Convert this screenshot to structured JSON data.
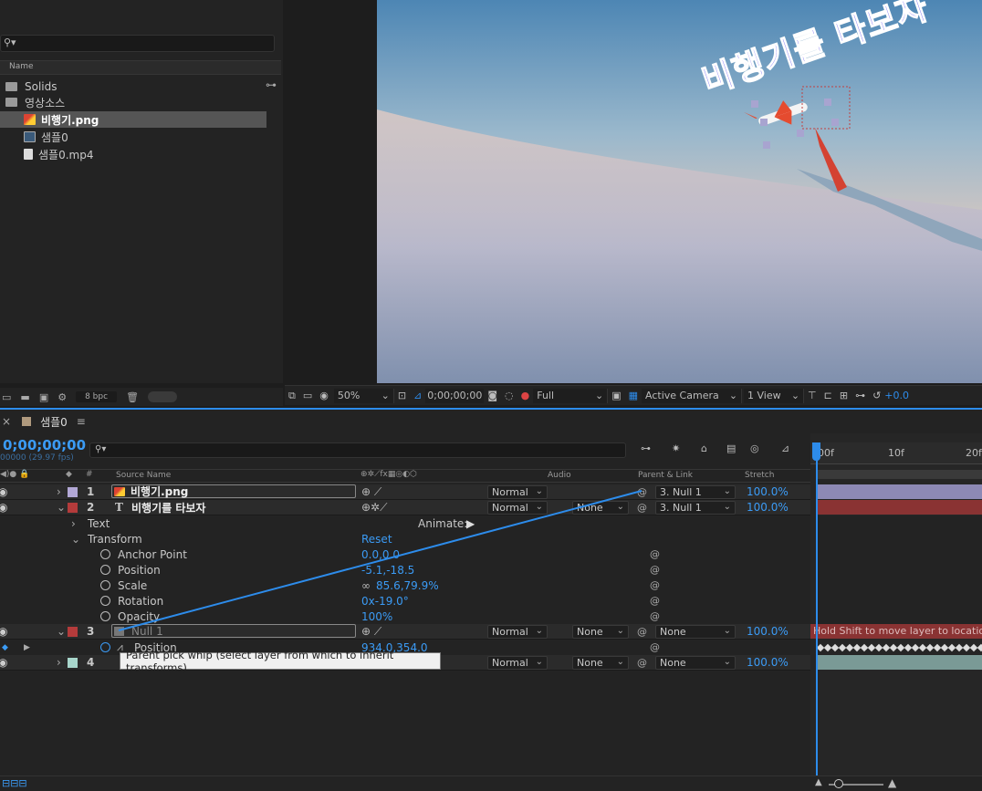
{
  "project": {
    "column_name": "Name",
    "items": [
      {
        "label": "Solids",
        "type": "folder"
      },
      {
        "label": "영상소스",
        "type": "folder"
      },
      {
        "label": "비행기.png",
        "type": "png",
        "selected": true
      },
      {
        "label": "샘플0",
        "type": "comp"
      },
      {
        "label": "샘플0.mp4",
        "type": "video"
      }
    ],
    "bpc": "8 bpc"
  },
  "viewer": {
    "overlay_text": "비행기를 타보자",
    "zoom": "50%",
    "timecode": "0;00;00;00",
    "resolution": "Full",
    "camera": "Active Camera",
    "view": "1 View",
    "exposure": "+0.0"
  },
  "timeline": {
    "comp_name": "샘플0",
    "timecode": "0;00;00;00",
    "fps": "00000 (29.97 fps)",
    "columns": {
      "source_name": "Source Name",
      "audio": "Audio",
      "parent_link": "Parent & Link",
      "stretch": "Stretch"
    },
    "ruler": [
      "00f",
      "10f",
      "20f"
    ],
    "layers": [
      {
        "num": "1",
        "name": "비행기.png",
        "mode": "Normal",
        "parent": "3. Null 1",
        "stretch": "100.0%",
        "color": "#b2a8d6"
      },
      {
        "num": "2",
        "name": "비행기를 타보자",
        "mode": "Normal",
        "trkmat": "None",
        "parent": "3. Null 1",
        "stretch": "100.0%",
        "color": "#b43b3b"
      },
      {
        "num": "3",
        "name": "Null 1",
        "mode": "Normal",
        "trkmat": "None",
        "parent": "None",
        "stretch": "100.0%",
        "color": "#b43b3b"
      },
      {
        "num": "4",
        "mode": "Normal",
        "trkmat": "None",
        "parent": "None",
        "stretch": "100.0%",
        "color": "#a8d6cc"
      }
    ],
    "text_group": "Text",
    "animate_label": "Animate:",
    "transform_group": "Transform",
    "reset_label": "Reset",
    "properties": [
      {
        "name": "Anchor Point",
        "value": "0.0,0.0"
      },
      {
        "name": "Position",
        "value": "-5.1,-18.5"
      },
      {
        "name": "Scale",
        "value": "85.6,79.9%"
      },
      {
        "name": "Rotation",
        "value": "0x-19.0°"
      },
      {
        "name": "Opacity",
        "value": "100%"
      }
    ],
    "null_position": {
      "name": "Position",
      "value": "934.0,354.0"
    },
    "shift_hint": "Hold Shift to move layer to location",
    "tooltip": "Parent pick whip (select layer from which to inherit transforms)"
  },
  "colors": {
    "accent": "#2d8ceb",
    "value_blue": "#3b9bf5",
    "red_bar": "#8a3333",
    "lavender_bar": "#8d89b5",
    "teal_bar": "#7a9a96"
  }
}
